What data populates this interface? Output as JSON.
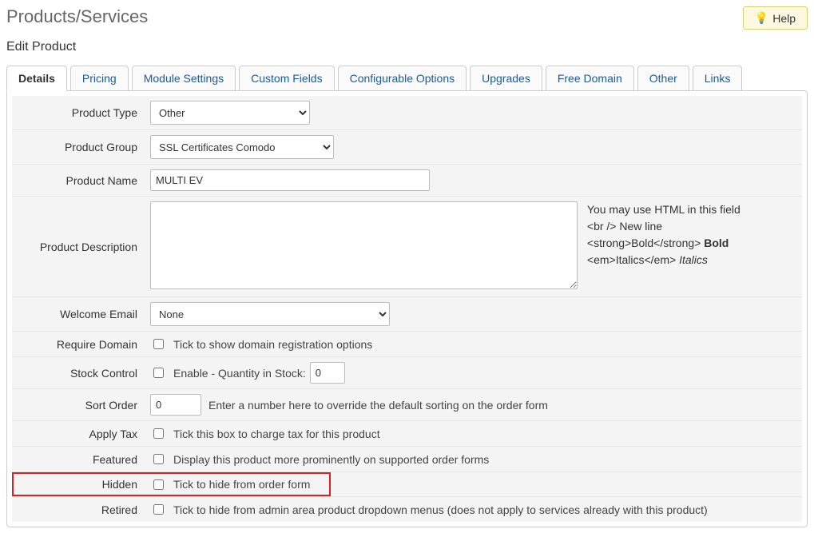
{
  "page_title": "Products/Services",
  "help_label": "Help",
  "subheading": "Edit Product",
  "tabs": [
    {
      "label": "Details",
      "active": true
    },
    {
      "label": "Pricing"
    },
    {
      "label": "Module Settings"
    },
    {
      "label": "Custom Fields"
    },
    {
      "label": "Configurable Options"
    },
    {
      "label": "Upgrades"
    },
    {
      "label": "Free Domain"
    },
    {
      "label": "Other"
    },
    {
      "label": "Links"
    }
  ],
  "fields": {
    "product_type": {
      "label": "Product Type",
      "value": "Other"
    },
    "product_group": {
      "label": "Product Group",
      "value": "SSL Certificates Comodo"
    },
    "product_name": {
      "label": "Product Name",
      "value": "MULTI EV"
    },
    "product_description": {
      "label": "Product Description",
      "value": "",
      "help_intro": "You may use HTML in this field",
      "help_br_code": "<br />",
      "help_br_text": " New line",
      "help_strong_code": "<strong>Bold</strong>",
      "help_strong_text": "Bold",
      "help_em_code": "<em>Italics</em>",
      "help_em_text": "Italics"
    },
    "welcome_email": {
      "label": "Welcome Email",
      "value": "None"
    },
    "require_domain": {
      "label": "Require Domain",
      "hint": "Tick to show domain registration options",
      "checked": false
    },
    "stock_control": {
      "label": "Stock Control",
      "hint": "Enable - Quantity in Stock:",
      "qty": "0",
      "checked": false
    },
    "sort_order": {
      "label": "Sort Order",
      "value": "0",
      "hint": "Enter a number here to override the default sorting on the order form"
    },
    "apply_tax": {
      "label": "Apply Tax",
      "hint": "Tick this box to charge tax for this product",
      "checked": false
    },
    "featured": {
      "label": "Featured",
      "hint": "Display this product more prominently on supported order forms",
      "checked": false
    },
    "hidden": {
      "label": "Hidden",
      "hint": "Tick to hide from order form",
      "checked": false
    },
    "retired": {
      "label": "Retired",
      "hint": "Tick to hide from admin area product dropdown menus (does not apply to services already with this product)",
      "checked": false
    }
  }
}
